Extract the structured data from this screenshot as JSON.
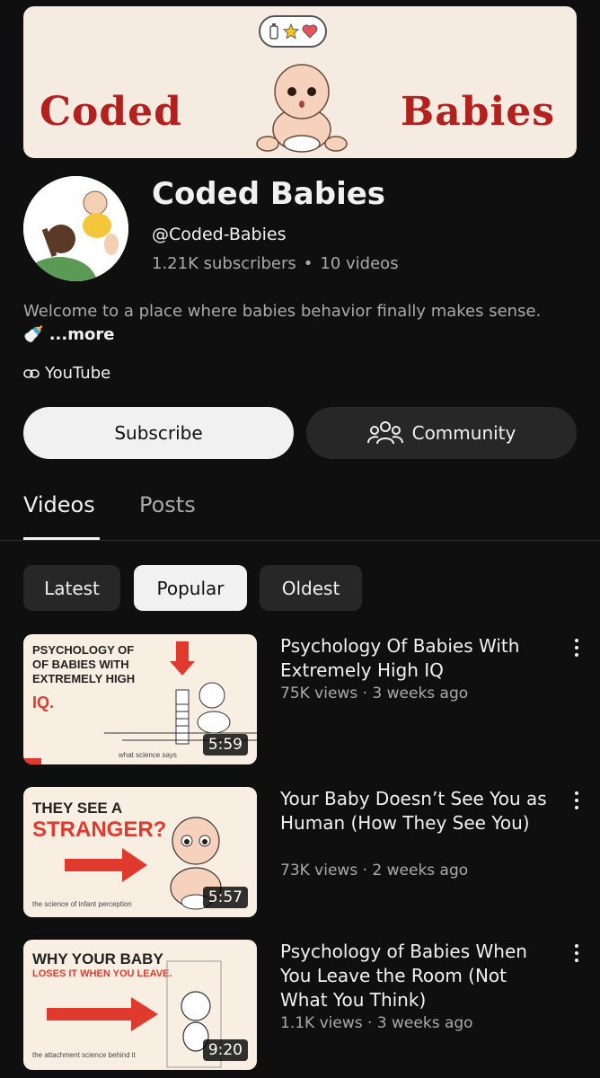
{
  "banner": {
    "left_text": "Coded",
    "right_text": "Babies"
  },
  "channel": {
    "name": "Coded Babies",
    "handle": "@Coded-Babies",
    "subscribers": "1.21K subscribers",
    "separator": "•",
    "video_count": "10 videos",
    "description": "Welcome to a place where babies behavior finally makes sense. 🍼",
    "more_label": " ...more",
    "link_label": "YouTube"
  },
  "actions": {
    "subscribe_label": "Subscribe",
    "community_label": "Community"
  },
  "tabs": [
    {
      "label": "Videos",
      "active": true
    },
    {
      "label": "Posts",
      "active": false
    }
  ],
  "chips": [
    {
      "label": "Latest",
      "active": false
    },
    {
      "label": "Popular",
      "active": true
    },
    {
      "label": "Oldest",
      "active": false
    }
  ],
  "videos": [
    {
      "title": "Psychology Of Babies With Extremely High IQ",
      "meta": "75K views · 3 weeks ago",
      "duration": "5:59",
      "thumb_lines": [
        "PSYCHOLOGY OF",
        "OF BABIES WITH",
        "EXTREMELY HIGH",
        "IQ."
      ],
      "thumb_caption": "what science says"
    },
    {
      "title": "Your Baby Doesn’t See You as Human (How They See You)",
      "meta": "73K views · 2 weeks ago",
      "duration": "5:57",
      "thumb_lines": [
        "THEY SEE A",
        "STRANGER?"
      ],
      "thumb_caption": "the science of infant perception"
    },
    {
      "title": "Psychology of Babies When You Leave the Room (Not What You Think)",
      "meta": "1.1K views · 3 weeks ago",
      "duration": "9:20",
      "thumb_lines": [
        "WHY YOUR BABY",
        "LOSES IT WHEN YOU LEAVE."
      ],
      "thumb_caption": "the attachment science behind it"
    }
  ],
  "colors": {
    "background": "#0f0f0f",
    "banner_bg": "#f5ebe0",
    "banner_text": "#b3211f",
    "thumb_red": "#e03a2f"
  }
}
